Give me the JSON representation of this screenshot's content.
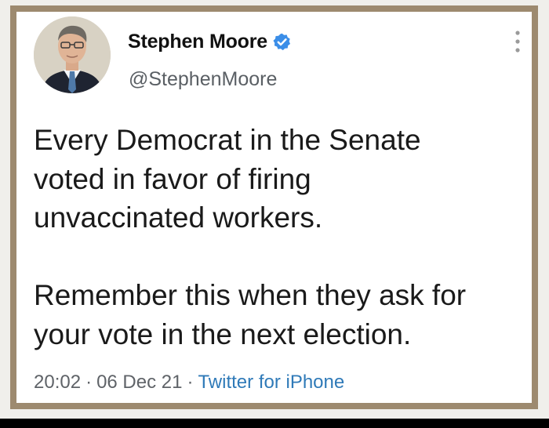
{
  "tweet": {
    "display_name": "Stephen Moore",
    "handle": "@StephenMoore",
    "verified": true,
    "text": "Every Democrat in the Senate\nvoted in favor of firing\nunvaccinated workers.\n\nRemember this when they ask for\nyour vote in the next election.",
    "time": "20:02",
    "date": "06 Dec 21",
    "separator": "·",
    "source": "Twitter for iPhone"
  },
  "icons": {
    "verified": "verified-badge-icon",
    "more": "more-vertical-icon",
    "avatar": "profile-photo"
  },
  "colors": {
    "frame_border": "#9d8a6f",
    "verified": "#3b8ee8",
    "link": "#2f7ab8",
    "text": "#1a1a1a",
    "muted": "#5f6368"
  }
}
